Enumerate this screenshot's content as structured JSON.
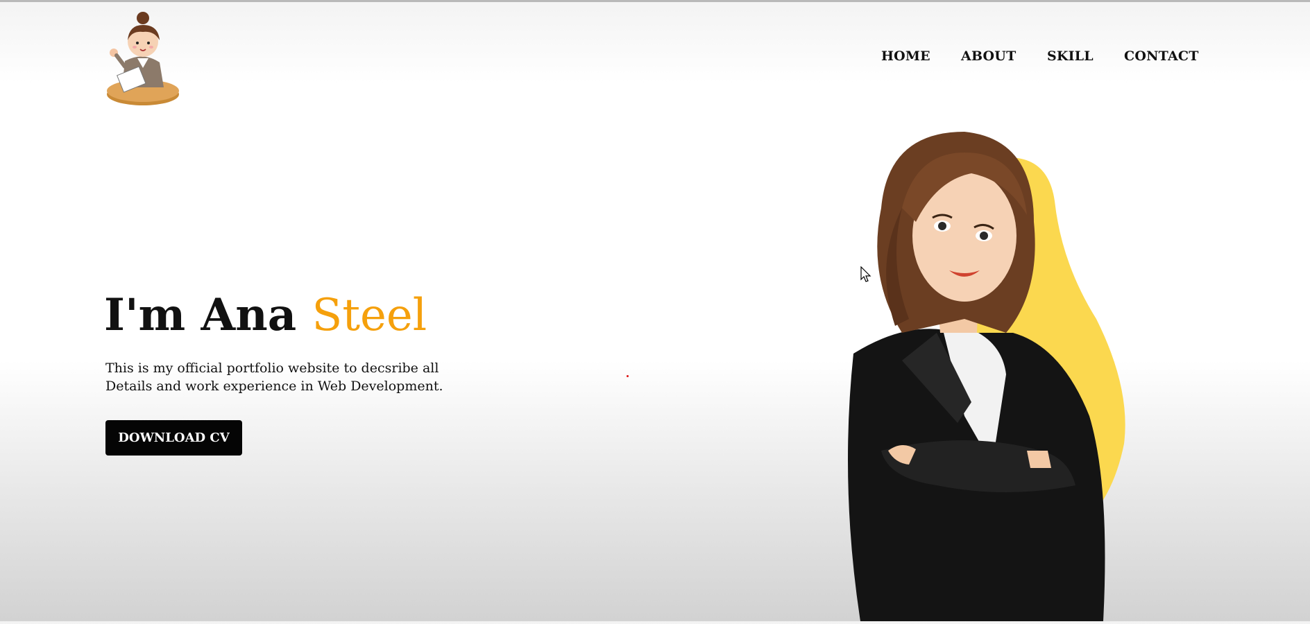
{
  "nav": {
    "items": [
      "HOME",
      "ABOUT",
      "SKILL",
      "CONTACT"
    ]
  },
  "hero": {
    "title_prefix": "I'm Ana ",
    "title_accent": "Steel",
    "description_line1": "This is my official portfolio website to decsribe all",
    "description_line2": "Details and work experience in Web Development.",
    "button_label": "DOWNLOAD CV"
  },
  "colors": {
    "accent": "#f5a00c",
    "button_bg": "#050505",
    "blob_yellow": "#fbd84f"
  },
  "icons": {
    "logo": "cartoon-girl-at-desk-logo",
    "cursor": "mouse-pointer-icon"
  }
}
